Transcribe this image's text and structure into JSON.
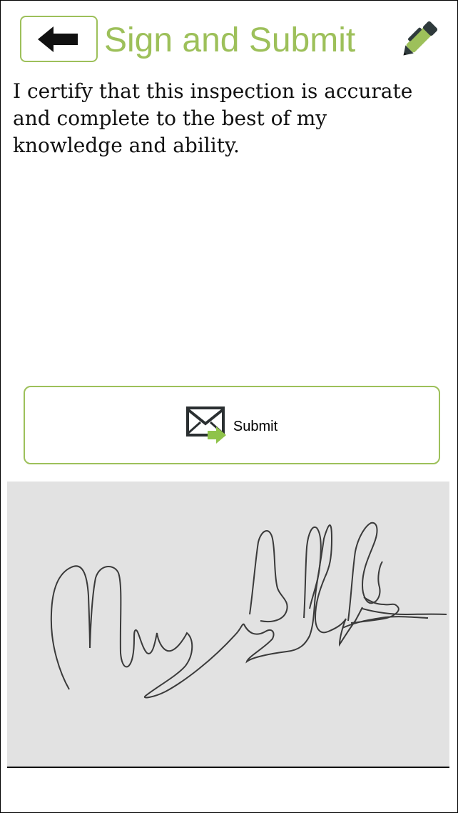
{
  "header": {
    "back_icon": "arrow-left-icon",
    "title": "Sign and Submit",
    "edit_icon": "pen-icon"
  },
  "certification_text": "I certify that this inspection is accurate and complete to the best of my knowledge and ability.",
  "submit_button": {
    "label": "Submit",
    "icon": "envelope-send-icon"
  },
  "signature_pad": {
    "has_signature": true
  },
  "colors": {
    "accent": "#9dc05a",
    "pad_background": "#e2e2e2",
    "text": "#111111"
  }
}
